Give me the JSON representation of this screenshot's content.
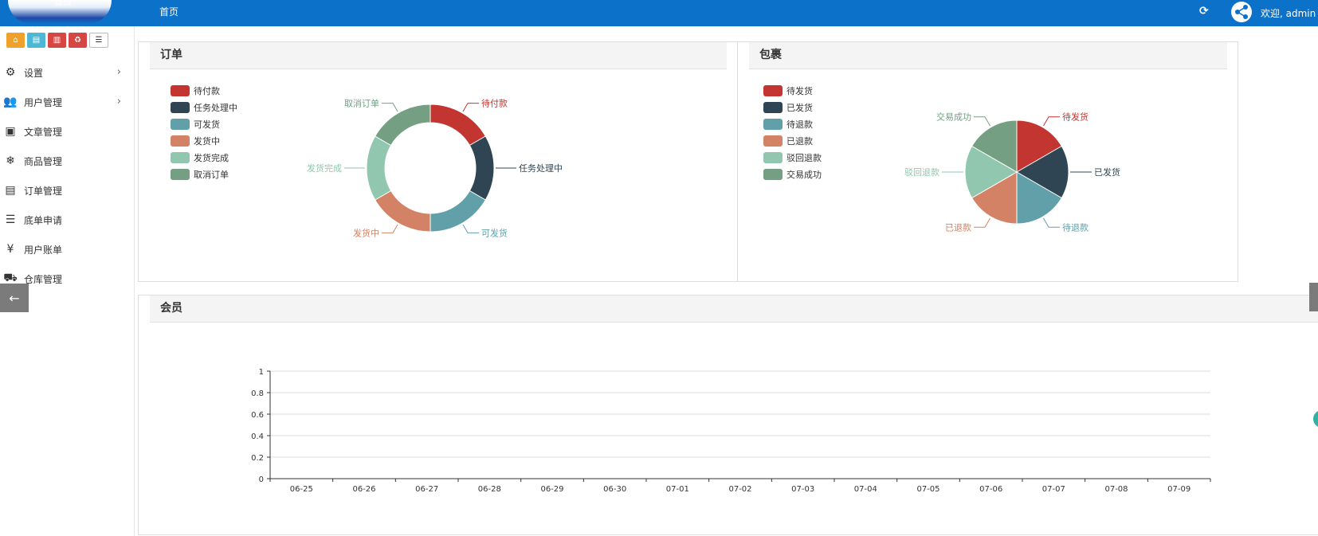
{
  "topbar": {
    "logo_text": "首页",
    "nav_home": "首页",
    "welcome": "欢迎, admin ▾",
    "refresh_icon": "refresh-icon",
    "share_icon": "share-nodes-icon"
  },
  "shortcuts": [
    {
      "icon": "home-icon",
      "color": "#f0a12a"
    },
    {
      "icon": "file-icon",
      "color": "#4cb8d6"
    },
    {
      "icon": "trash-icon",
      "color": "#d64743"
    },
    {
      "icon": "recycle-icon",
      "color": "#d64743"
    },
    {
      "icon": "list-icon",
      "color": "#ffffff"
    }
  ],
  "sidebar": {
    "items": [
      {
        "label": "设置",
        "icon": "gears-icon",
        "chevron": true
      },
      {
        "label": "用户管理",
        "icon": "users-icon",
        "chevron": true
      },
      {
        "label": "文章管理",
        "icon": "newspaper-icon",
        "chevron": false
      },
      {
        "label": "商品管理",
        "icon": "snowflake-icon",
        "chevron": false
      },
      {
        "label": "订单管理",
        "icon": "server-icon",
        "chevron": false
      },
      {
        "label": "底单申请",
        "icon": "bars-icon",
        "chevron": false
      },
      {
        "label": "用户账单",
        "icon": "yen-icon",
        "chevron": false
      },
      {
        "label": "仓库管理",
        "icon": "truck-icon",
        "chevron": false
      }
    ],
    "collapse_icon": "arrow-left-icon"
  },
  "panels": {
    "orders_title": "订单",
    "packages_title": "包裹",
    "members_title": "会员"
  },
  "chart_data": [
    {
      "type": "pie",
      "variant": "donut",
      "categories": [
        "待付款",
        "任务处理中",
        "可发货",
        "发货中",
        "发货完成",
        "取消订单"
      ],
      "values": [
        1,
        1,
        1,
        1,
        1,
        1
      ],
      "colors": [
        "#c23531",
        "#2f4554",
        "#61a0a8",
        "#d48265",
        "#91c7ae",
        "#749f83"
      ],
      "legend_position": "top-left"
    },
    {
      "type": "pie",
      "categories": [
        "待发货",
        "已发货",
        "待退款",
        "已退款",
        "驳回退款",
        "交易成功"
      ],
      "values": [
        1,
        1,
        1,
        1,
        1,
        1
      ],
      "colors": [
        "#c23531",
        "#2f4554",
        "#61a0a8",
        "#d48265",
        "#91c7ae",
        "#749f83"
      ],
      "legend_position": "top-left"
    },
    {
      "type": "line",
      "x": [
        "06-25",
        "06-26",
        "06-27",
        "06-28",
        "06-29",
        "06-30",
        "07-01",
        "07-02",
        "07-03",
        "07-04",
        "07-05",
        "07-06",
        "07-07",
        "07-08",
        "07-09"
      ],
      "series": [],
      "ylim": [
        0,
        1
      ],
      "yticks": [
        "0",
        "0.2",
        "0.4",
        "0.6",
        "0.8",
        "1"
      ],
      "grid": true
    }
  ]
}
